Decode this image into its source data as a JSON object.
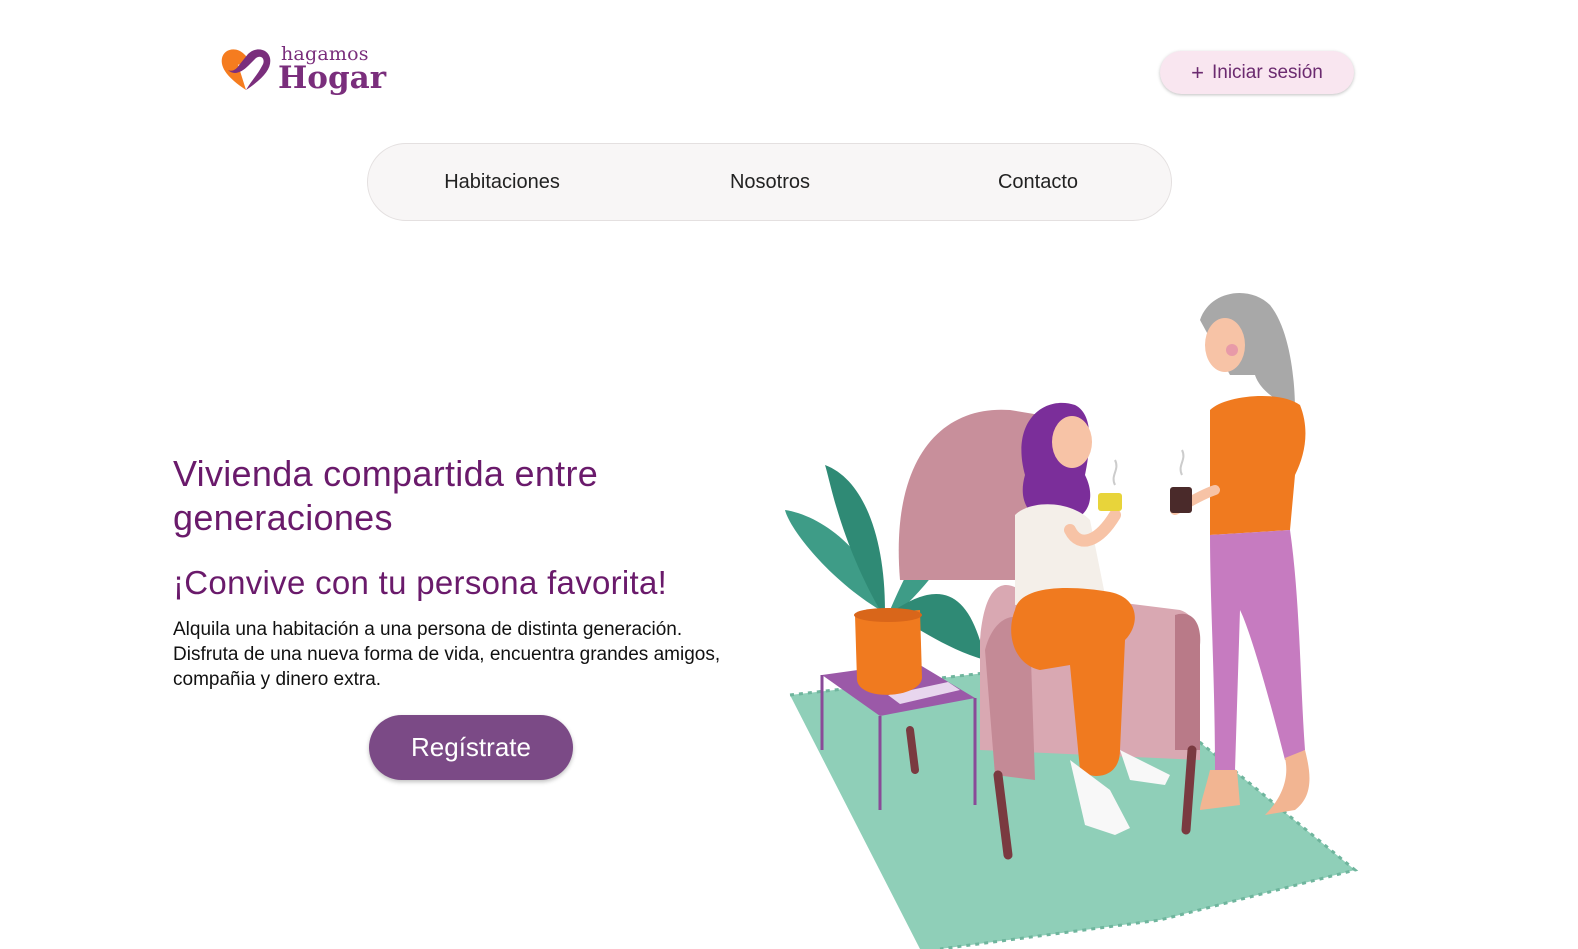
{
  "header": {
    "logo": {
      "small_text": "hagamos",
      "big_text": "Hogar"
    },
    "login_button": {
      "icon": "plus-icon",
      "label": "Iniciar sesión"
    }
  },
  "nav": {
    "items": [
      {
        "label": "Habitaciones"
      },
      {
        "label": "Nosotros"
      },
      {
        "label": "Contacto"
      }
    ]
  },
  "hero": {
    "title": "Vivienda compartida entre generaciones",
    "subtitle": "¡Convive con tu persona favorita!",
    "body_lines": [
      "Alquila una habitación a una persona de distinta generación.",
      "Disfruta de una nueva forma de vida, encuentra grandes amigos,",
      "compañia y dinero extra."
    ],
    "cta_label": "Regístrate"
  },
  "colors": {
    "brand_purple": "#6a1a6b",
    "brand_orange": "#f57c1f",
    "cta_bg": "#7b4a86",
    "login_bg": "#f9e6f0"
  }
}
